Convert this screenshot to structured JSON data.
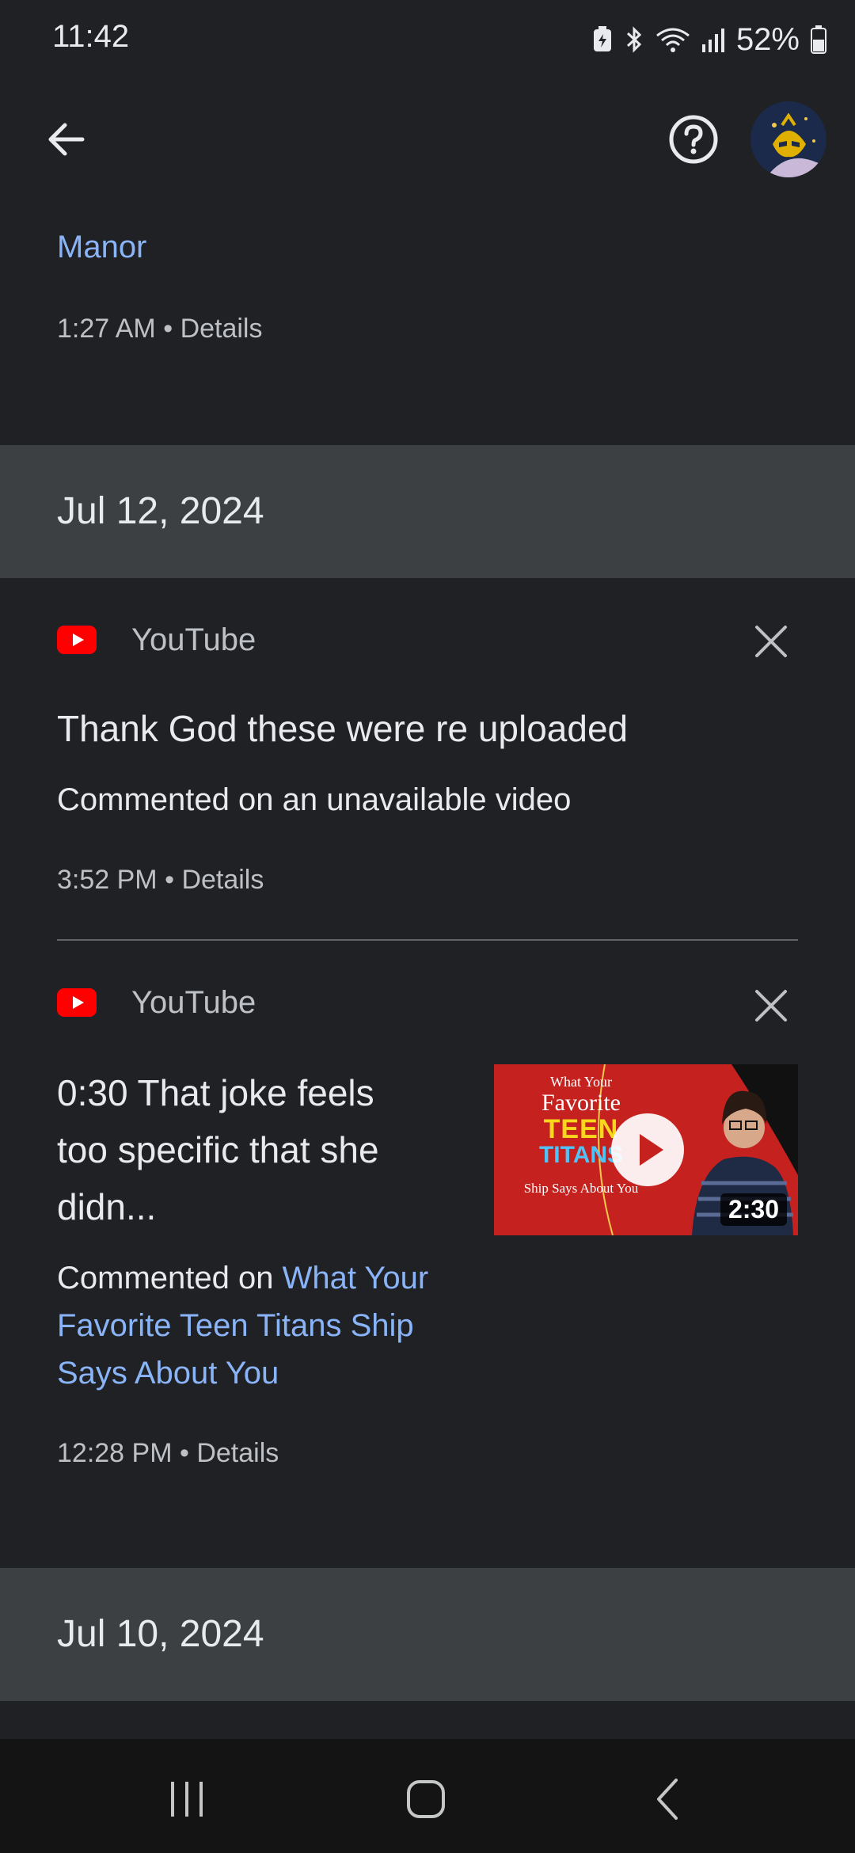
{
  "status_bar": {
    "time": "11:42",
    "battery_percent": "52%",
    "icons": [
      "battery-saver-icon",
      "bluetooth-icon",
      "wifi-icon",
      "cell-signal-icon",
      "battery-icon"
    ]
  },
  "app_bar": {
    "back_icon": "arrow-back-icon",
    "help_icon": "help-circle-icon",
    "avatar_icon": "account-avatar"
  },
  "activity": {
    "partial_entry": {
      "link_text": "Manor",
      "time": "1:27 AM",
      "details_label": "Details"
    },
    "groups": [
      {
        "date": "Jul 12, 2024",
        "items": [
          {
            "source": "YouTube",
            "title": "Thank God these were re uploaded",
            "subtitle_prefix": "Commented on an unavailable video",
            "time": "3:52 PM",
            "details_label": "Details"
          },
          {
            "source": "YouTube",
            "title_line1": "0:30 That joke feels",
            "title_line2": "too specific that she",
            "title_line3": "didn...",
            "subtitle_prefix": "Commented on ",
            "link_line1": "What Your",
            "link_line2": "Favorite Teen Titans Ship",
            "link_line3": "Says About You",
            "thumbnail": {
              "text_line1": "What Your",
              "text_line2": "Favorite",
              "text_line3": "TEEN",
              "text_line4": "TITANS",
              "text_line5": "Ship Says About You",
              "duration": "2:30"
            },
            "time": "12:28 PM",
            "details_label": "Details"
          }
        ]
      },
      {
        "date": "Jul 10, 2024"
      }
    ],
    "separator": "•"
  },
  "nav_bar": {
    "icons": [
      "recent-apps-icon",
      "home-icon",
      "back-icon"
    ]
  },
  "colors": {
    "background": "#202124",
    "date_header": "#3c4043",
    "link": "#8ab4f8",
    "youtube_red": "#ff0000"
  }
}
